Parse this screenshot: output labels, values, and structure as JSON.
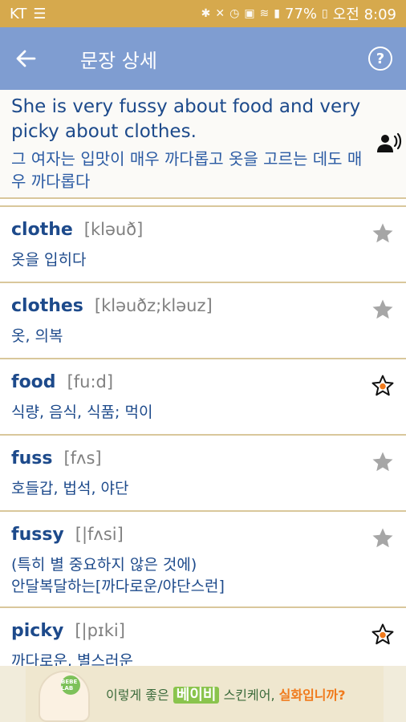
{
  "status_bar": {
    "carrier": "KT",
    "menu_glyph": "☰",
    "battery": "77%",
    "time": "오전 8:09",
    "icons": [
      "bluetooth-icon",
      "mute-icon",
      "alarm-icon",
      "nfc-icon",
      "wifi-icon",
      "signal-icon",
      "battery-icon"
    ]
  },
  "app_bar": {
    "back_glyph": "←",
    "title": "문장 상세",
    "help_glyph": "?"
  },
  "sentence": {
    "english": "She is very fussy about food and very picky about clothes.",
    "korean": "그 여자는 입맛이 매우 까다롭고 옷을 고르는 데도 매우 까다롭다"
  },
  "words": [
    {
      "word": "clothe",
      "phonetic": "[kləuð]",
      "meaning": "옷을 입히다",
      "starred": false
    },
    {
      "word": "clothes",
      "phonetic": "[kləuðz;kləuz]",
      "meaning": "옷, 의복",
      "starred": false
    },
    {
      "word": "food",
      "phonetic": "[fu:d]",
      "meaning": "식량, 음식, 식품; 먹이",
      "starred": true
    },
    {
      "word": "fuss",
      "phonetic": "[fʌs]",
      "meaning": "호들갑, 법석, 야단",
      "starred": false
    },
    {
      "word": "fussy",
      "phonetic": "[|fʌsi]",
      "meaning_line1": "(특히 별 중요하지 않은 것에)",
      "meaning_line2": "안달복달하는[까다로운/야단스런]",
      "starred": false
    },
    {
      "word": "picky",
      "phonetic": "[|pɪki]",
      "meaning": "까다로운, 별스러운",
      "starred": true
    }
  ],
  "ad": {
    "logo": "BEBE LAB",
    "text_1": "이렇게 좋은",
    "highlight": "베이비",
    "text_2": "스킨케어,",
    "highlight_2": "실화입니까?"
  },
  "colors": {
    "status_bar": "#d6a94d",
    "app_bar": "#7f9dd1",
    "word_text": "#1d4a8b",
    "divider": "#d9c79b",
    "star_gray": "#a6a6a6",
    "star_active_dot": "#f07a1c"
  }
}
